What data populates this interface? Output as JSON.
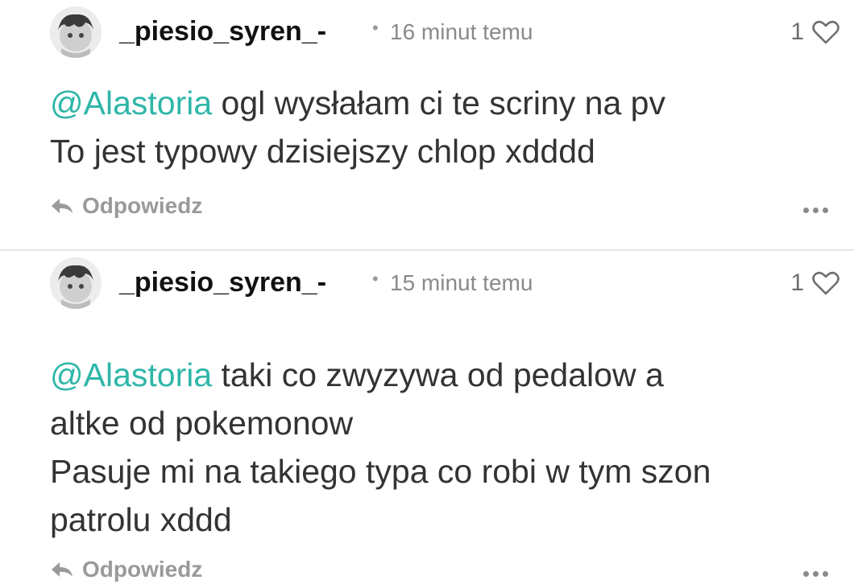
{
  "comments": [
    {
      "username": "_piesio_syren_-",
      "separator": "•",
      "time": "16 minut temu",
      "likes": "1",
      "mention": "@Alastoria",
      "lines": [
        " ogl wysłałam ci te scriny na pv",
        "To jest typowy dzisiejszy chlop xdddd"
      ],
      "reply_label": "Odpowiedz"
    },
    {
      "username": "_piesio_syren_-",
      "separator": "•",
      "time": "15 minut temu",
      "likes": "1",
      "mention": "@Alastoria",
      "lines": [
        " taki co zwyzywa od pedalow a",
        "altke od pokemonow",
        "Pasuje mi na takiego typa co robi w tym szon",
        "patrolu xddd"
      ],
      "reply_label": "Odpowiedz"
    }
  ],
  "icons": {
    "like": "heart-outline-icon",
    "reply": "reply-arrow-icon",
    "more": "more-dots-icon",
    "avatar": "avatar-image"
  },
  "colors": {
    "mention": "#2fb6a8",
    "text": "#333333",
    "muted": "#8a8a8a",
    "divider": "#e6e6e6"
  }
}
